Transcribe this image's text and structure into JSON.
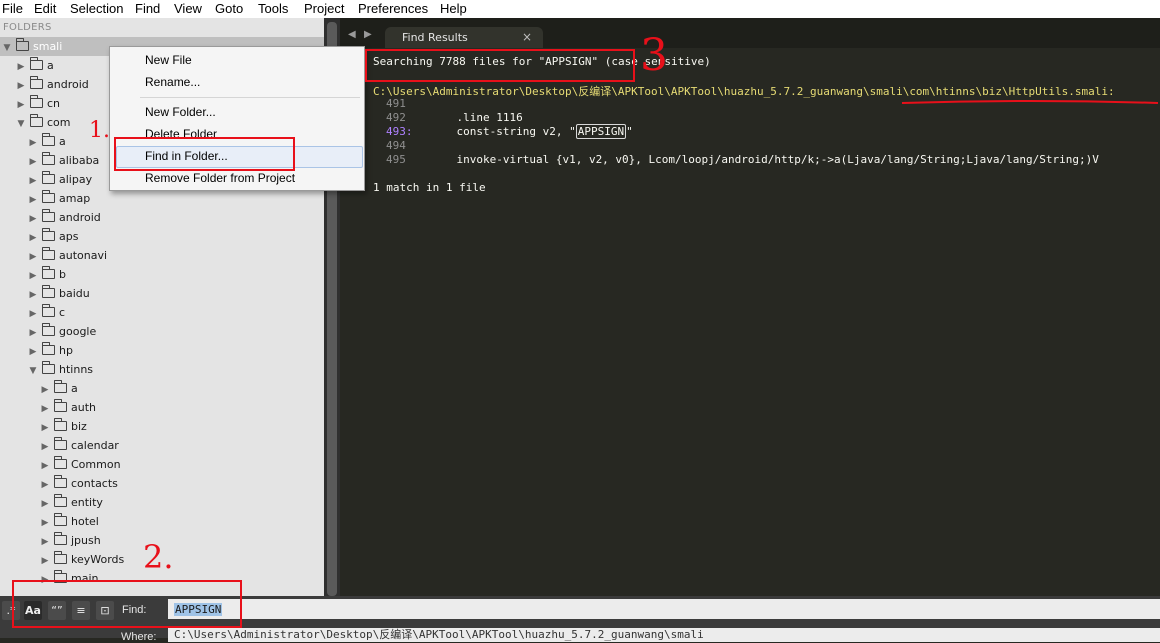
{
  "menu": [
    "File",
    "Edit",
    "Selection",
    "Find",
    "View",
    "Goto",
    "Tools",
    "Project",
    "Preferences",
    "Help"
  ],
  "sidebar": {
    "header": "FOLDERS",
    "root": "smali",
    "items": [
      "a",
      "android",
      "cn",
      "com",
      "a",
      "alibaba",
      "alipay",
      "amap",
      "android",
      "aps",
      "autonavi",
      "b",
      "baidu",
      "c",
      "google",
      "hp",
      "htinns",
      "a",
      "auth",
      "biz",
      "calendar",
      "Common",
      "contacts",
      "entity",
      "hotel",
      "jpush",
      "keyWords",
      "main"
    ]
  },
  "context_menu": {
    "items": [
      "New File",
      "Rename...",
      "New Folder...",
      "Delete Folder",
      "Find in Folder...",
      "Remove Folder from Project"
    ]
  },
  "tabs": {
    "active": "Find Results",
    "close": "×"
  },
  "results": {
    "summary": "Searching 7788 files for \"APPSIGN\" (case sensitive)",
    "file_path": "C:\\Users\\Administrator\\Desktop\\反编译\\APKTool\\APKTool\\huazhu_5.7.2_guanwang\\smali\\com\\htinns\\biz\\HttpUtils.smali:",
    "lines": [
      {
        "num": "491",
        "code": ""
      },
      {
        "num": "492",
        "code": "    .line 1116"
      },
      {
        "num": "493:",
        "code_pre": "    const-string v2, \"",
        "match": "APPSIGN",
        "code_post": "\""
      },
      {
        "num": "494",
        "code": ""
      },
      {
        "num": "495",
        "code": "    invoke-virtual {v1, v2, v0}, Lcom/loopj/android/http/k;->a(Ljava/lang/String;Ljava/lang/String;)V"
      }
    ],
    "footer": "1 match in 1 file"
  },
  "find_panel": {
    "buttons": [
      ".*",
      "Aa",
      "“”",
      "≡",
      "⊡"
    ],
    "find_label": "Find:",
    "find_value": "APPSIGN",
    "where_label": "Where:",
    "where_value": "C:\\Users\\Administrator\\Desktop\\反编译\\APKTool\\APKTool\\huazhu_5.7.2_guanwang\\smali"
  },
  "annotations": [
    "1.",
    "2.",
    "3"
  ]
}
